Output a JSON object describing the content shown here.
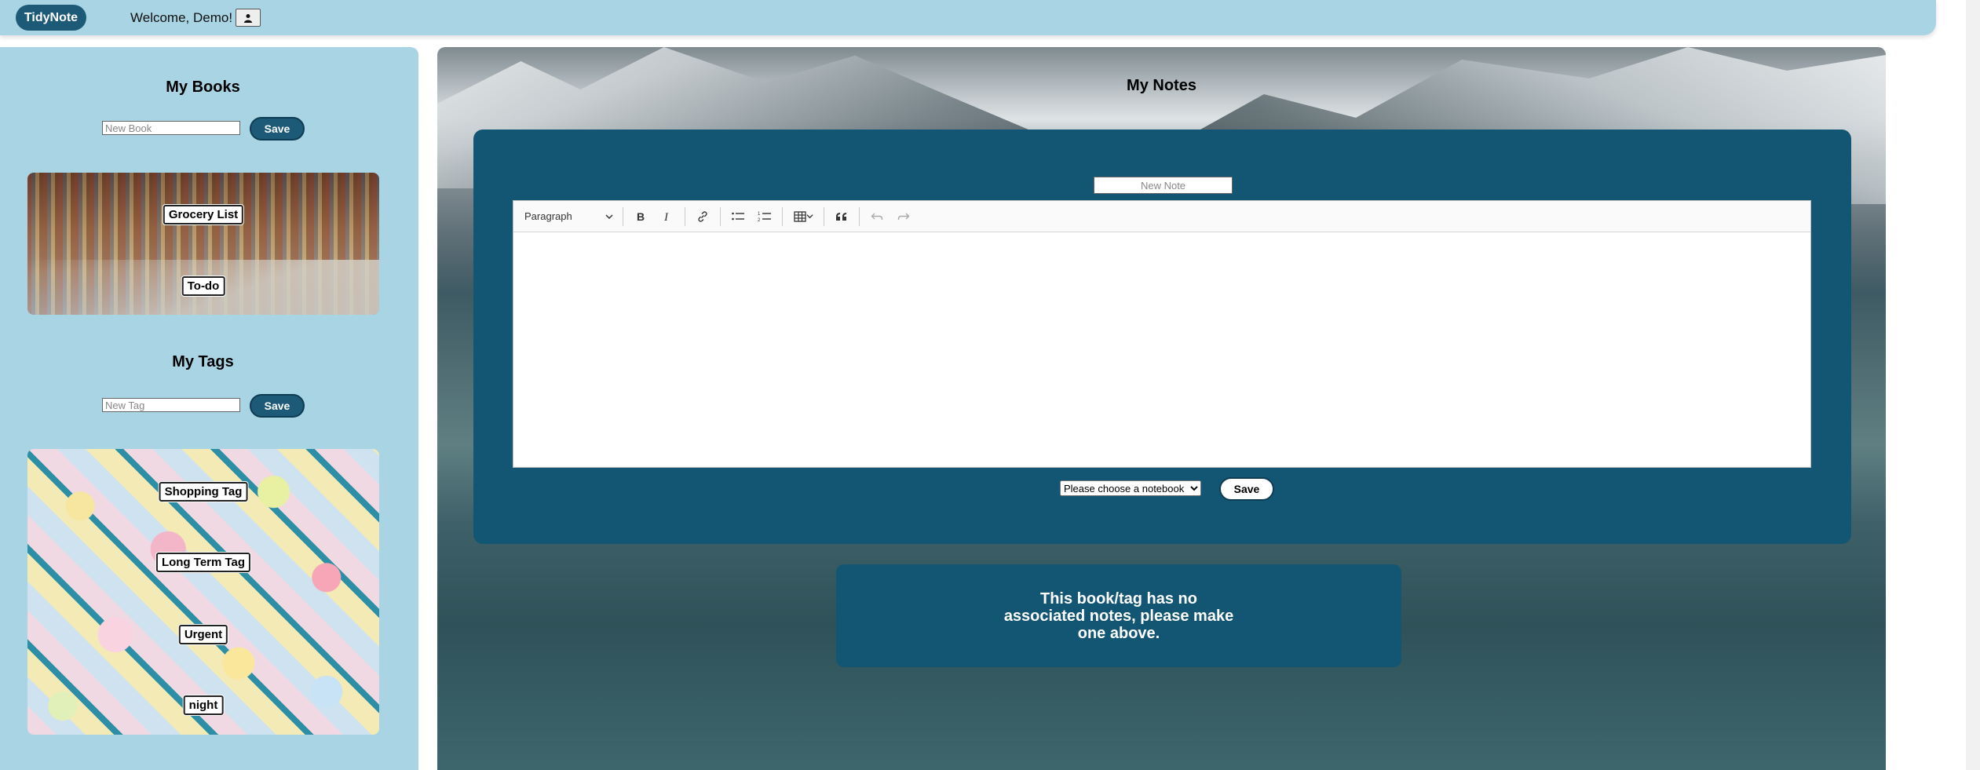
{
  "navbar": {
    "brand": "TidyNote",
    "welcome": "Welcome, Demo!"
  },
  "sidebar": {
    "books": {
      "title": "My Books",
      "input_placeholder": "New Book",
      "save_label": "Save",
      "items": [
        "Grocery List",
        "To-do"
      ]
    },
    "tags": {
      "title": "My Tags",
      "input_placeholder": "New Tag",
      "save_label": "Save",
      "items": [
        "Shopping Tag",
        "Long Term Tag",
        "Urgent",
        "night"
      ]
    }
  },
  "main": {
    "title": "My Notes",
    "note_title_placeholder": "New Note",
    "editor": {
      "block_format": "Paragraph"
    },
    "notebook_select": "Please choose a notebook",
    "save_label": "Save",
    "empty_message": "This book/tag has no associated notes, please make one above."
  },
  "colors": {
    "navbar_bg": "#a9d4e3",
    "accent_dark": "#125674",
    "brand_bg": "#1c5a78"
  }
}
